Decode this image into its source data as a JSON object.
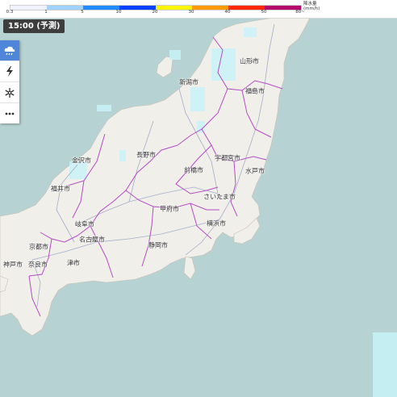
{
  "legend": {
    "ticks": [
      "0.3",
      "1",
      "5",
      "10",
      "20",
      "30",
      "40",
      "50",
      "80~"
    ],
    "unit_label": "降水量",
    "unit": "(mm/h)",
    "colors": [
      "#f2f2ff",
      "#a0d2ff",
      "#218cff",
      "#0041ff",
      "#faf500",
      "#ff9900",
      "#ff2800",
      "#b40068"
    ]
  },
  "time_badge": "15:00 (予測)",
  "toolbar": {
    "buttons": [
      {
        "name": "rain-cloud-icon",
        "active": true
      },
      {
        "name": "lightning-icon",
        "active": false
      },
      {
        "name": "snow-icon",
        "active": false
      },
      {
        "name": "more-icon",
        "active": false
      }
    ]
  },
  "cities": [
    {
      "name": "山形市"
    },
    {
      "name": "新潟市"
    },
    {
      "name": "福島市"
    },
    {
      "name": "金沢市"
    },
    {
      "name": "長野市"
    },
    {
      "name": "宇都宮市"
    },
    {
      "name": "前橋市"
    },
    {
      "name": "水戸市"
    },
    {
      "name": "福井市"
    },
    {
      "name": "さいたま市"
    },
    {
      "name": "甲府市"
    },
    {
      "name": "岐阜市"
    },
    {
      "name": "横浜市"
    },
    {
      "name": "名古屋市"
    },
    {
      "name": "京都市"
    },
    {
      "name": "静岡市"
    },
    {
      "name": "神戸市"
    },
    {
      "name": "奈良市"
    },
    {
      "name": "津市"
    }
  ],
  "colors": {
    "sea": "#b7d2d2",
    "land": "#f1efea",
    "prefecture_border": "#b44cc4",
    "road": "#9ca6c8",
    "rain_light": "#c8f3f8"
  }
}
